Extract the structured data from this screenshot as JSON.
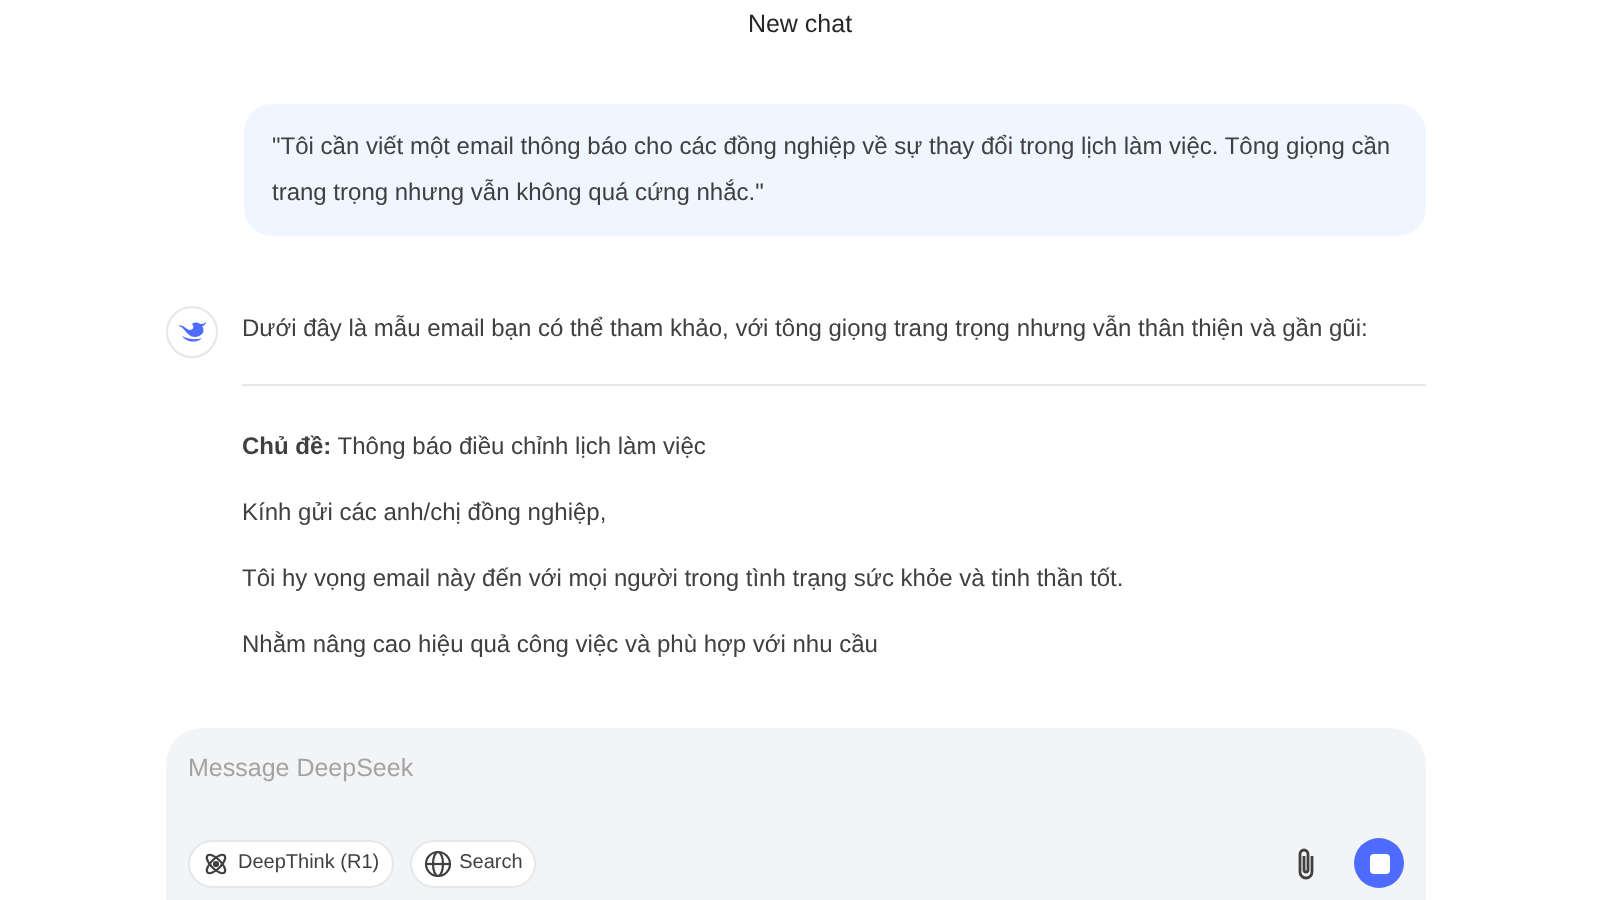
{
  "header": {
    "title": "New chat"
  },
  "messages": [
    {
      "kind": "user",
      "text": "\"Tôi cần viết một email thông báo cho các đồng nghiệp về sự thay đổi trong lịch làm việc. Tông giọng cần trang trọng nhưng vẫn không quá cứng nhắc.\""
    },
    {
      "kind": "assistant",
      "intro": "Dưới đây là mẫu email bạn có thể tham khảo, với tông giọng trang trọng nhưng vẫn thân thiện và gần gũi:",
      "paragraphs": [
        "**Chủ đề:** Thông báo điều chỉnh lịch làm việc",
        "Kính gửi các anh/chị đồng nghiệp,",
        "Tôi hy vọng email này đến với mọi người trong tình trạng sức khỏe và tinh thần tốt.",
        "Nhằm nâng cao hiệu quả công việc và phù hợp với nhu cầu"
      ]
    }
  ],
  "composer": {
    "placeholder": "Message DeepSeek",
    "toggles": [
      {
        "kind": "deepthink",
        "label": "DeepThink (R1)",
        "on": false
      },
      {
        "kind": "search",
        "label": "Search",
        "on": false
      }
    ]
  }
}
